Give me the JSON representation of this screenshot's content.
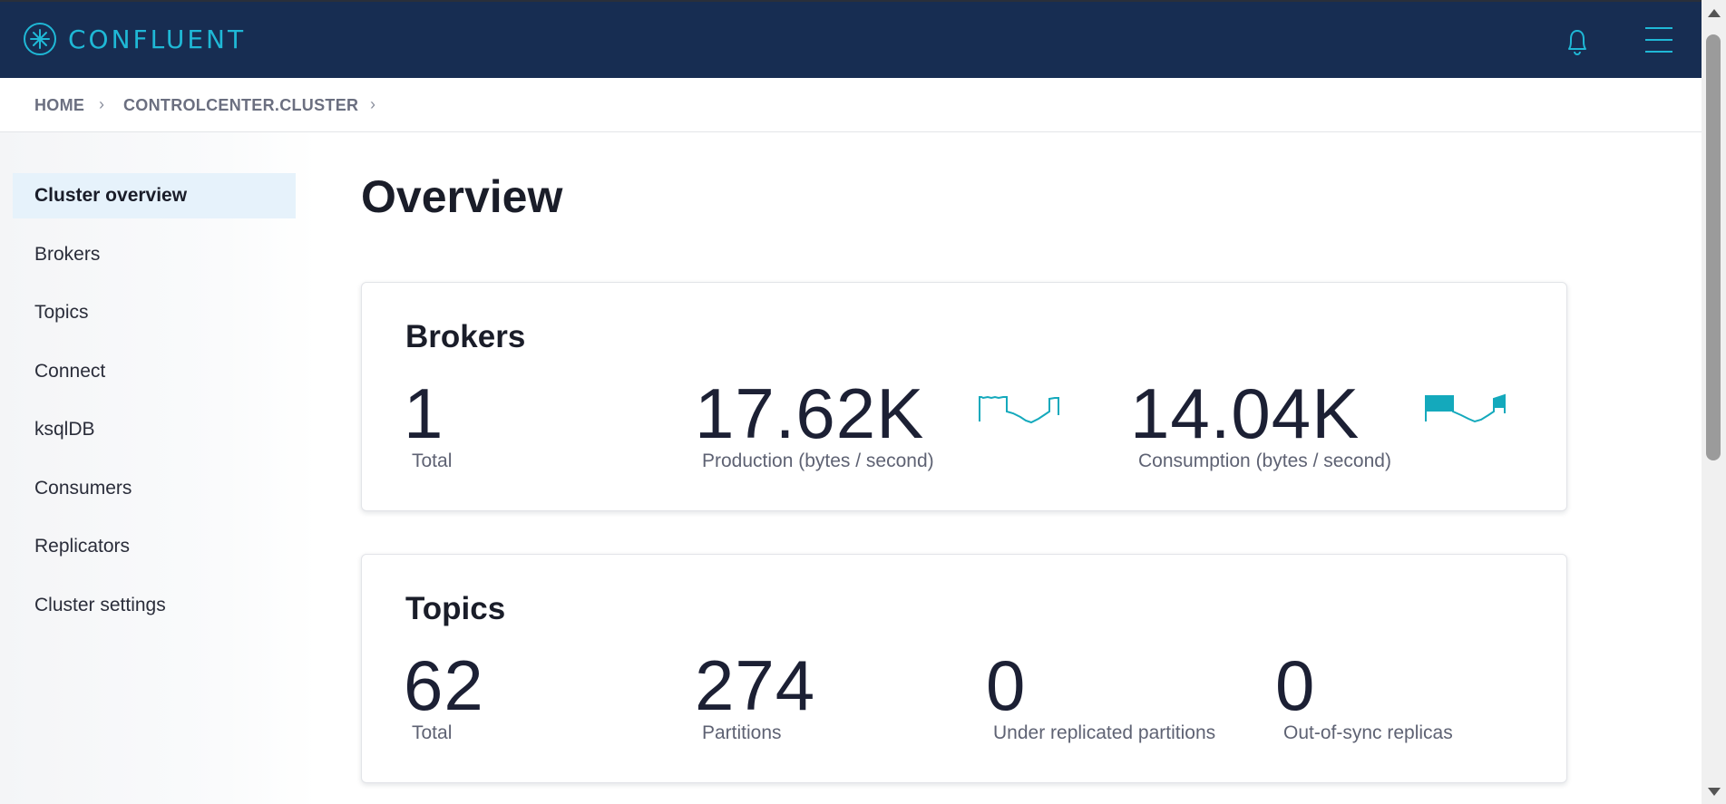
{
  "app": {
    "brand": "CONFLUENT",
    "icons": {
      "logo": "confluent-logo-icon",
      "notifications": "bell-icon",
      "menu": "hamburger-menu-icon"
    },
    "colors": {
      "topbar": "#172d52",
      "accent": "#1fb8d6",
      "spark": "#14a9bc",
      "active_nav": "#e6f2fb"
    }
  },
  "breadcrumb": {
    "home": "HOME",
    "cluster": "CONTROLCENTER.CLUSTER",
    "separator": "›"
  },
  "sidebar": {
    "items": [
      {
        "label": "Cluster overview",
        "active": true
      },
      {
        "label": "Brokers"
      },
      {
        "label": "Topics"
      },
      {
        "label": "Connect"
      },
      {
        "label": "ksqlDB"
      },
      {
        "label": "Consumers"
      },
      {
        "label": "Replicators"
      },
      {
        "label": "Cluster settings"
      }
    ]
  },
  "main": {
    "title": "Overview",
    "brokers": {
      "title": "Brokers",
      "total": {
        "value": "1",
        "label": "Total"
      },
      "production": {
        "value": "17.62K",
        "label": "Production (bytes / second)"
      },
      "consumption": {
        "value": "14.04K",
        "label": "Consumption (bytes / second)"
      }
    },
    "topics": {
      "title": "Topics",
      "total": {
        "value": "62",
        "label": "Total"
      },
      "partitions": {
        "value": "274",
        "label": "Partitions"
      },
      "under_replicated": {
        "value": "0",
        "label": "Under replicated partitions"
      },
      "out_of_sync": {
        "value": "0",
        "label": "Out-of-sync replicas"
      }
    }
  }
}
